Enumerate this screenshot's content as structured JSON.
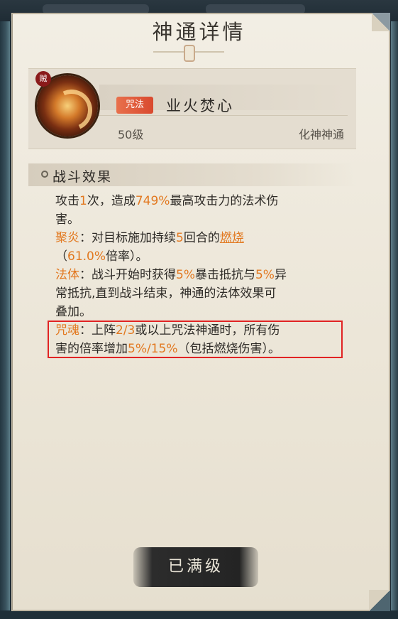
{
  "header": {
    "title": "神通详情"
  },
  "skill": {
    "badge": "贼",
    "tag": "咒法",
    "name": "业火焚心",
    "level": "50级",
    "category": "化神神通"
  },
  "effects": {
    "section_title": "战斗效果",
    "line1": {
      "a": "攻击",
      "b": "1",
      "c": "次，造成",
      "d": "749%",
      "e": "最高攻击力的法术伤",
      "f": "害。"
    },
    "line2": {
      "label": "聚炎",
      "a": "：对目标施加持续",
      "b": "5",
      "c": "回合的",
      "d": "燃烧",
      "e": "（",
      "f": "61.0%",
      "g": "倍率）。"
    },
    "line3": {
      "label": "法体",
      "a": "：战斗开始时获得",
      "b": "5%",
      "c": "暴击抵抗与",
      "d": "5%",
      "e": "异",
      "f": "常抵抗,直到战斗结束，神通的法体效果可",
      "g": "叠加。"
    },
    "line4": {
      "label": "咒魂",
      "a": "：上阵",
      "b": "2/3",
      "c": "或以上咒法神通时，所有伤",
      "d": "害的倍率增加",
      "e": "5%/15%",
      "f": "（包括燃烧伤害）。"
    }
  },
  "footer": {
    "button": "已满级"
  }
}
